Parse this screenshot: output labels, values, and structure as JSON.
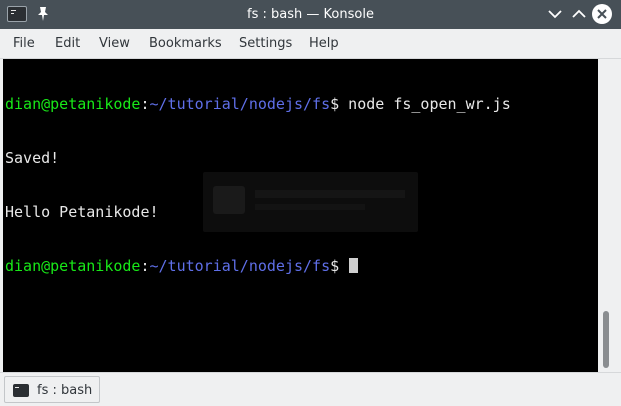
{
  "window": {
    "title": "fs : bash — Konsole",
    "icons": {
      "app": "terminal-icon",
      "pin": "pin-icon",
      "minimize": "chevron-down-icon",
      "maximize": "chevron-up-icon",
      "close": "close-icon"
    }
  },
  "menu": {
    "items": [
      "File",
      "Edit",
      "View",
      "Bookmarks",
      "Settings",
      "Help"
    ]
  },
  "terminal": {
    "prompt_user": "dian@petanikode",
    "prompt_sep": ":",
    "prompt_path": "~/tutorial/nodejs/fs",
    "prompt_symbol": "$",
    "command": " node fs_open_wr.js",
    "output": [
      "Saved!",
      "Hello Petanikode!"
    ]
  },
  "tabs": [
    {
      "label": "fs : bash",
      "icon": "terminal-icon"
    }
  ],
  "colors": {
    "titlebar": "#475057",
    "terminal_bg": "#000000",
    "prompt_user": "#18e818",
    "prompt_path": "#5f6fe8",
    "text": "#e8e8e8"
  }
}
